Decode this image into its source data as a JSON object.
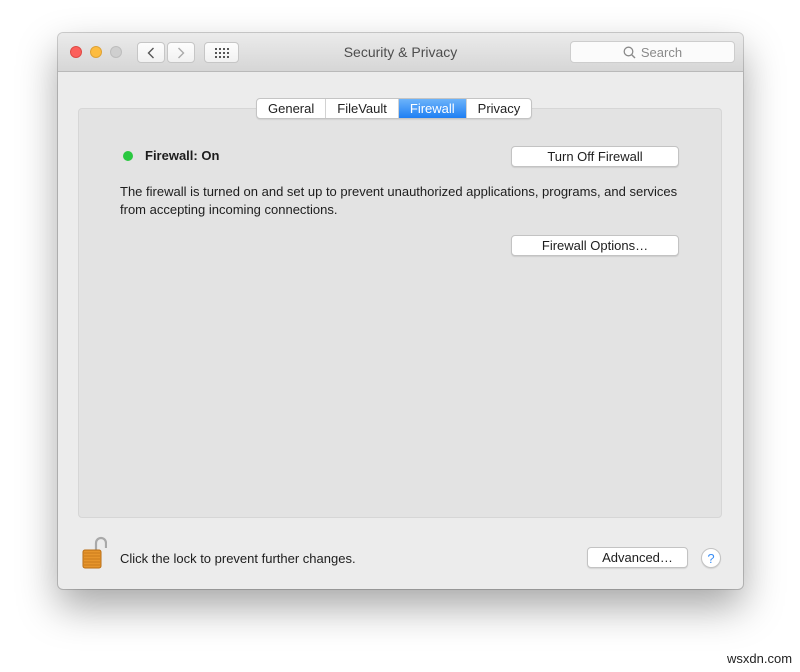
{
  "window": {
    "title": "Security & Privacy",
    "search_placeholder": "Search",
    "nav": {
      "back_icon": "chevron-left-icon",
      "forward_icon": "chevron-right-icon",
      "grid_icon": "show-all-grid-icon"
    }
  },
  "tabs": [
    {
      "label": "General",
      "active": false
    },
    {
      "label": "FileVault",
      "active": false
    },
    {
      "label": "Firewall",
      "active": true
    },
    {
      "label": "Privacy",
      "active": false
    }
  ],
  "firewall": {
    "status_label": "Firewall: On",
    "status_color": "#2ac840",
    "turn_off_button": "Turn Off Firewall",
    "description": "The firewall is turned on and set up to prevent unauthorized applications, programs, and services from accepting incoming connections.",
    "options_button": "Firewall Options…"
  },
  "footer": {
    "lock_text": "Click the lock to prevent further changes.",
    "advanced_button": "Advanced…",
    "help_label": "?"
  },
  "watermark": "wsxdn.com",
  "colors": {
    "accent": "#1f7ff3",
    "close": "#fc605c",
    "minimize": "#fdbc40"
  }
}
